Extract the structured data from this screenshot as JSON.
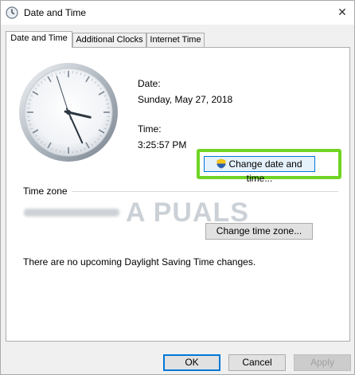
{
  "window": {
    "title": "Date and Time"
  },
  "tabs": [
    {
      "label": "Date and Time"
    },
    {
      "label": "Additional Clocks"
    },
    {
      "label": "Internet Time"
    }
  ],
  "date": {
    "label": "Date:",
    "value": "Sunday, May 27, 2018"
  },
  "time": {
    "label": "Time:",
    "value": "3:25:57 PM"
  },
  "buttons": {
    "change_datetime": "Change date and time...",
    "change_timezone": "Change time zone...",
    "ok": "OK",
    "cancel": "Cancel",
    "apply": "Apply"
  },
  "timezone": {
    "heading": "Time zone"
  },
  "dst_message": "There are no upcoming Daylight Saving Time changes.",
  "watermark": "A  PUALS",
  "colors": {
    "highlight": "#6fd423",
    "accent": "#0078d7"
  },
  "clock": {
    "hour": 3,
    "minute": 25,
    "second": 57
  }
}
